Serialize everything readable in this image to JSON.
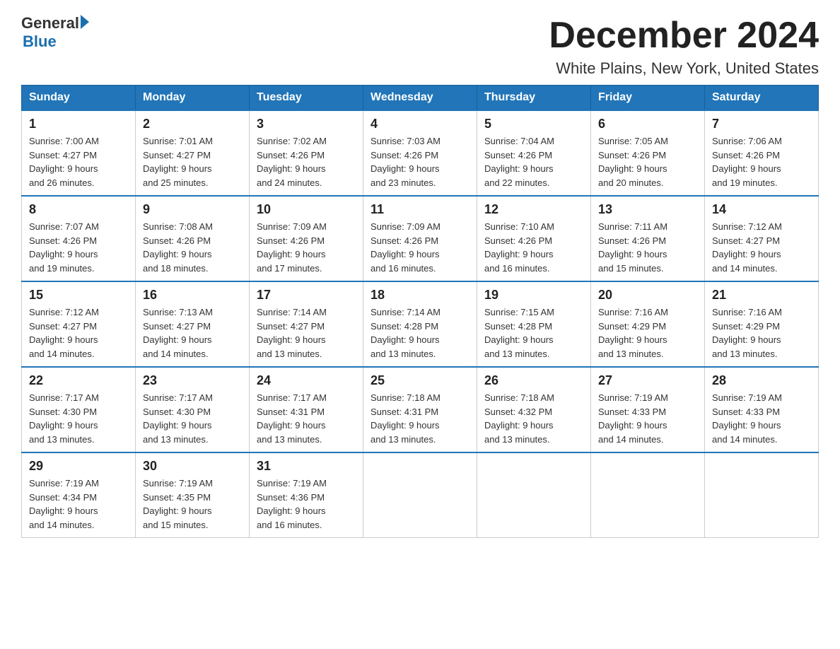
{
  "logo": {
    "text_general": "General",
    "arrow": "▶",
    "text_blue": "Blue"
  },
  "title": "December 2024",
  "location": "White Plains, New York, United States",
  "weekdays": [
    "Sunday",
    "Monday",
    "Tuesday",
    "Wednesday",
    "Thursday",
    "Friday",
    "Saturday"
  ],
  "weeks": [
    [
      {
        "day": "1",
        "sunrise": "7:00 AM",
        "sunset": "4:27 PM",
        "daylight": "9 hours and 26 minutes."
      },
      {
        "day": "2",
        "sunrise": "7:01 AM",
        "sunset": "4:27 PM",
        "daylight": "9 hours and 25 minutes."
      },
      {
        "day": "3",
        "sunrise": "7:02 AM",
        "sunset": "4:26 PM",
        "daylight": "9 hours and 24 minutes."
      },
      {
        "day": "4",
        "sunrise": "7:03 AM",
        "sunset": "4:26 PM",
        "daylight": "9 hours and 23 minutes."
      },
      {
        "day": "5",
        "sunrise": "7:04 AM",
        "sunset": "4:26 PM",
        "daylight": "9 hours and 22 minutes."
      },
      {
        "day": "6",
        "sunrise": "7:05 AM",
        "sunset": "4:26 PM",
        "daylight": "9 hours and 20 minutes."
      },
      {
        "day": "7",
        "sunrise": "7:06 AM",
        "sunset": "4:26 PM",
        "daylight": "9 hours and 19 minutes."
      }
    ],
    [
      {
        "day": "8",
        "sunrise": "7:07 AM",
        "sunset": "4:26 PM",
        "daylight": "9 hours and 19 minutes."
      },
      {
        "day": "9",
        "sunrise": "7:08 AM",
        "sunset": "4:26 PM",
        "daylight": "9 hours and 18 minutes."
      },
      {
        "day": "10",
        "sunrise": "7:09 AM",
        "sunset": "4:26 PM",
        "daylight": "9 hours and 17 minutes."
      },
      {
        "day": "11",
        "sunrise": "7:09 AM",
        "sunset": "4:26 PM",
        "daylight": "9 hours and 16 minutes."
      },
      {
        "day": "12",
        "sunrise": "7:10 AM",
        "sunset": "4:26 PM",
        "daylight": "9 hours and 16 minutes."
      },
      {
        "day": "13",
        "sunrise": "7:11 AM",
        "sunset": "4:26 PM",
        "daylight": "9 hours and 15 minutes."
      },
      {
        "day": "14",
        "sunrise": "7:12 AM",
        "sunset": "4:27 PM",
        "daylight": "9 hours and 14 minutes."
      }
    ],
    [
      {
        "day": "15",
        "sunrise": "7:12 AM",
        "sunset": "4:27 PM",
        "daylight": "9 hours and 14 minutes."
      },
      {
        "day": "16",
        "sunrise": "7:13 AM",
        "sunset": "4:27 PM",
        "daylight": "9 hours and 14 minutes."
      },
      {
        "day": "17",
        "sunrise": "7:14 AM",
        "sunset": "4:27 PM",
        "daylight": "9 hours and 13 minutes."
      },
      {
        "day": "18",
        "sunrise": "7:14 AM",
        "sunset": "4:28 PM",
        "daylight": "9 hours and 13 minutes."
      },
      {
        "day": "19",
        "sunrise": "7:15 AM",
        "sunset": "4:28 PM",
        "daylight": "9 hours and 13 minutes."
      },
      {
        "day": "20",
        "sunrise": "7:16 AM",
        "sunset": "4:29 PM",
        "daylight": "9 hours and 13 minutes."
      },
      {
        "day": "21",
        "sunrise": "7:16 AM",
        "sunset": "4:29 PM",
        "daylight": "9 hours and 13 minutes."
      }
    ],
    [
      {
        "day": "22",
        "sunrise": "7:17 AM",
        "sunset": "4:30 PM",
        "daylight": "9 hours and 13 minutes."
      },
      {
        "day": "23",
        "sunrise": "7:17 AM",
        "sunset": "4:30 PM",
        "daylight": "9 hours and 13 minutes."
      },
      {
        "day": "24",
        "sunrise": "7:17 AM",
        "sunset": "4:31 PM",
        "daylight": "9 hours and 13 minutes."
      },
      {
        "day": "25",
        "sunrise": "7:18 AM",
        "sunset": "4:31 PM",
        "daylight": "9 hours and 13 minutes."
      },
      {
        "day": "26",
        "sunrise": "7:18 AM",
        "sunset": "4:32 PM",
        "daylight": "9 hours and 13 minutes."
      },
      {
        "day": "27",
        "sunrise": "7:19 AM",
        "sunset": "4:33 PM",
        "daylight": "9 hours and 14 minutes."
      },
      {
        "day": "28",
        "sunrise": "7:19 AM",
        "sunset": "4:33 PM",
        "daylight": "9 hours and 14 minutes."
      }
    ],
    [
      {
        "day": "29",
        "sunrise": "7:19 AM",
        "sunset": "4:34 PM",
        "daylight": "9 hours and 14 minutes."
      },
      {
        "day": "30",
        "sunrise": "7:19 AM",
        "sunset": "4:35 PM",
        "daylight": "9 hours and 15 minutes."
      },
      {
        "day": "31",
        "sunrise": "7:19 AM",
        "sunset": "4:36 PM",
        "daylight": "9 hours and 16 minutes."
      },
      null,
      null,
      null,
      null
    ]
  ],
  "labels": {
    "sunrise": "Sunrise: ",
    "sunset": "Sunset: ",
    "daylight": "Daylight: "
  }
}
